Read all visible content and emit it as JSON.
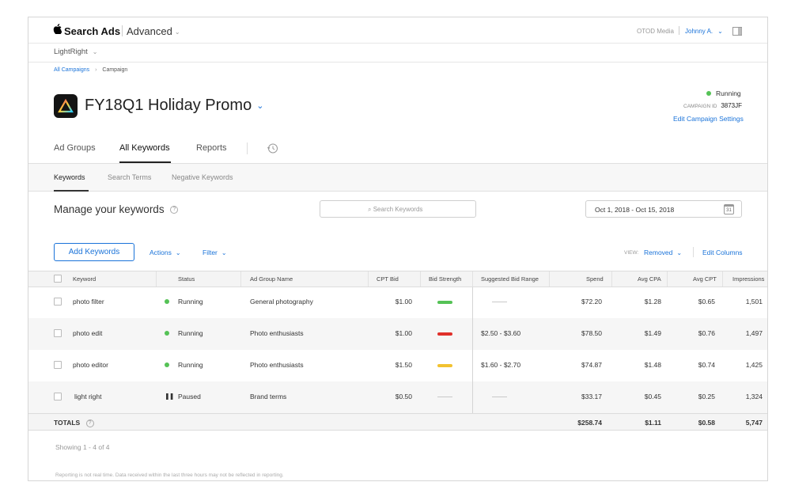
{
  "header": {
    "brand": "Search Ads",
    "mode": "Advanced",
    "org": "OTOD Media",
    "user": "Johnny A."
  },
  "app_selector": {
    "label": "LightRight"
  },
  "breadcrumb": {
    "root": "All Campaigns",
    "current": "Campaign"
  },
  "campaign": {
    "name": "FY18Q1 Holiday Promo",
    "status": "Running",
    "id_label": "CAMPAIGN ID",
    "id": "3873JF",
    "edit_link": "Edit Campaign Settings"
  },
  "main_tabs": [
    "Ad Groups",
    "All Keywords",
    "Reports"
  ],
  "sub_tabs": [
    "Keywords",
    "Search Terms",
    "Negative Keywords"
  ],
  "section": {
    "title": "Manage your keywords",
    "search_placeholder": "Search Keywords",
    "date_range": "Oct 1, 2018 - Oct 15, 2018",
    "calendar_day": "31"
  },
  "toolbar": {
    "add_keywords": "Add Keywords",
    "actions": "Actions",
    "filter": "Filter",
    "view_label": "VIEW:",
    "view_value": "Removed",
    "edit_columns": "Edit Columns"
  },
  "table": {
    "columns": [
      "Keyword",
      "Status",
      "Ad Group Name",
      "CPT Bid",
      "Bid Strength",
      "Suggested Bid Range",
      "Spend",
      "Avg CPA",
      "Avg CPT",
      "Impressions"
    ],
    "rows": [
      {
        "keyword": "photo filter",
        "status": "Running",
        "ad_group": "General photography",
        "cpt_bid": "$1.00",
        "strength": "green",
        "range": "",
        "spend": "$72.20",
        "cpa": "$1.28",
        "cpt": "$0.65",
        "impressions": "1,501"
      },
      {
        "keyword": "photo edit",
        "status": "Running",
        "ad_group": "Photo enthusiasts",
        "cpt_bid": "$1.00",
        "strength": "red",
        "range": "$2.50 - $3.60",
        "spend": "$78.50",
        "cpa": "$1.49",
        "cpt": "$0.76",
        "impressions": "1,497"
      },
      {
        "keyword": "photo editor",
        "status": "Running",
        "ad_group": "Photo enthusiasts",
        "cpt_bid": "$1.50",
        "strength": "yellow",
        "range": "$1.60 - $2.70",
        "spend": "$74.87",
        "cpa": "$1.48",
        "cpt": "$0.74",
        "impressions": "1,425"
      },
      {
        "keyword": "light right",
        "status": "Paused",
        "ad_group": "Brand terms",
        "cpt_bid": "$0.50",
        "strength": "none",
        "range": "",
        "spend": "$33.17",
        "cpa": "$0.45",
        "cpt": "$0.25",
        "impressions": "1,324"
      }
    ],
    "totals": {
      "label": "TOTALS",
      "spend": "$258.74",
      "cpa": "$1.11",
      "cpt": "$0.58",
      "impressions": "5,747"
    }
  },
  "footer": {
    "showing": "Showing 1 - 4 of 4",
    "note": "Reporting is not real time. Data received within the last three hours may not be reflected in reporting."
  },
  "colors": {
    "accent": "#1a73d9",
    "running": "#55c256",
    "strength_green": "#55c256",
    "strength_red": "#e0302b",
    "strength_yellow": "#f2c230"
  }
}
